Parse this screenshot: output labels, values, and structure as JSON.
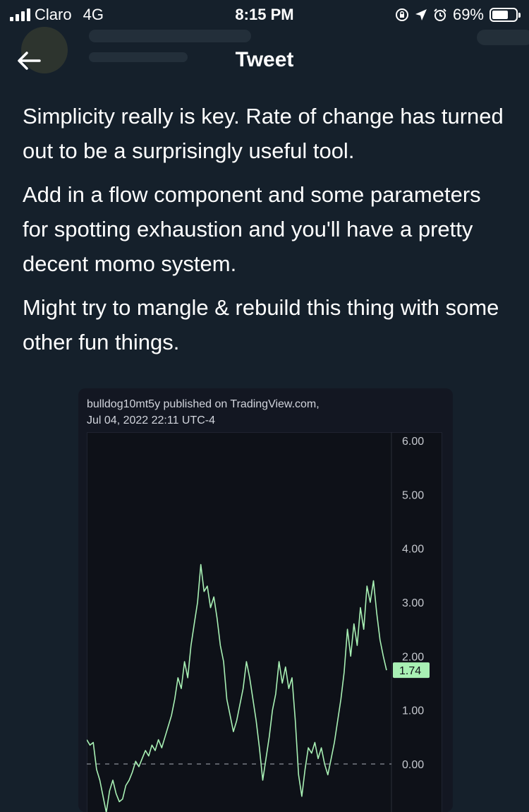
{
  "status_bar": {
    "carrier": "Claro",
    "network": "4G",
    "time": "8:15 PM",
    "battery_percent": "69%",
    "battery_level": 0.69,
    "icons": [
      "signal-icon",
      "rotation-lock-icon",
      "location-arrow-icon",
      "alarm-icon",
      "battery-icon"
    ]
  },
  "nav": {
    "title": "Tweet",
    "back_icon": "back-arrow-icon"
  },
  "tweet": {
    "paragraphs": [
      "Simplicity really is key. Rate of change has turned out to be a surprisingly useful tool.",
      "Add in a flow component and some parameters for spotting exhaustion and you'll have a pretty decent momo system.",
      "Might try to mangle & rebuild this thing with some other fun things."
    ]
  },
  "chart": {
    "header_line1": "bulldog10mt5y published on TradingView.com,",
    "header_line2": "Jul 04, 2022 22:11 UTC-4",
    "colors": {
      "line": "#a8f0b4",
      "background": "#0e1118",
      "badge": "#a8f0b4",
      "zero_line": "#8a8f99"
    },
    "chart_data": {
      "type": "line",
      "y_ticks": [
        "6.00",
        "5.00",
        "4.00",
        "3.00",
        "2.00",
        "1.00",
        "0.00"
      ],
      "ylim": [
        -0.8,
        6.0
      ],
      "last_value_label": "1.74",
      "last_value": 1.74,
      "zero_line": 0,
      "grid": false,
      "series": [
        {
          "values": [
            0.45,
            0.35,
            0.4,
            -0.1,
            -0.3,
            -0.6,
            -0.9,
            -0.5,
            -0.3,
            -0.55,
            -0.7,
            -0.65,
            -0.4,
            -0.3,
            -0.15,
            0.05,
            -0.05,
            0.1,
            0.25,
            0.15,
            0.35,
            0.25,
            0.45,
            0.3,
            0.5,
            0.7,
            0.9,
            1.2,
            1.6,
            1.4,
            1.9,
            1.6,
            2.2,
            2.6,
            3.0,
            3.7,
            3.2,
            3.3,
            2.9,
            3.1,
            2.7,
            2.2,
            1.9,
            1.2,
            0.9,
            0.6,
            0.8,
            1.1,
            1.4,
            1.9,
            1.6,
            1.2,
            0.8,
            0.3,
            -0.3,
            0.1,
            0.5,
            1.0,
            1.3,
            1.9,
            1.5,
            1.8,
            1.4,
            1.6,
            0.8,
            -0.2,
            -0.6,
            -0.1,
            0.3,
            0.2,
            0.4,
            0.1,
            0.3,
            0.0,
            -0.2,
            0.1,
            0.4,
            0.8,
            1.2,
            1.7,
            2.5,
            2.0,
            2.6,
            2.2,
            2.9,
            2.5,
            3.3,
            3.0,
            3.4,
            2.8,
            2.3,
            2.0,
            1.74
          ]
        }
      ]
    }
  }
}
